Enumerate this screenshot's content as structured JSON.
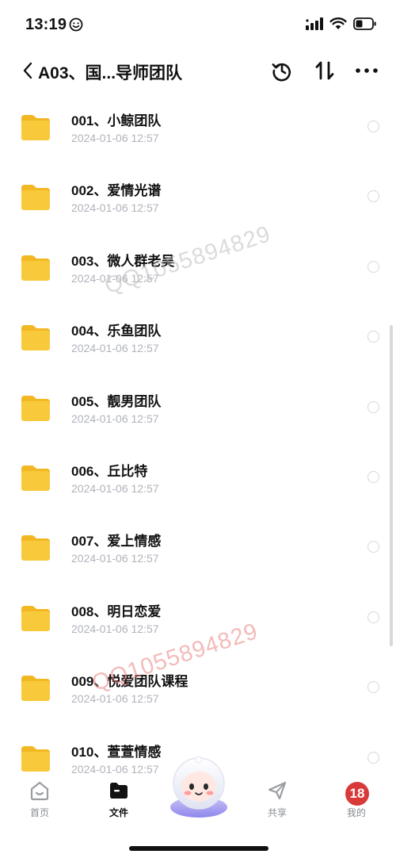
{
  "status_bar": {
    "time": "13:19"
  },
  "nav": {
    "title": "A03、国...导师团队"
  },
  "files": [
    {
      "name": "001、小鲸团队",
      "date": "2024-01-06 12:57"
    },
    {
      "name": "002、爱情光谱",
      "date": "2024-01-06 12:57"
    },
    {
      "name": "003、微人群老吴",
      "date": "2024-01-06 12:57"
    },
    {
      "name": "004、乐鱼团队",
      "date": "2024-01-06 12:57"
    },
    {
      "name": "005、靓男团队",
      "date": "2024-01-06 12:57"
    },
    {
      "name": "006、丘比特",
      "date": "2024-01-06 12:57"
    },
    {
      "name": "007、爱上情感",
      "date": "2024-01-06 12:57"
    },
    {
      "name": "008、明日恋爱",
      "date": "2024-01-06 12:57"
    },
    {
      "name": "009、悦爱团队课程",
      "date": "2024-01-06 12:57"
    },
    {
      "name": "010、萱萱情感",
      "date": "2024-01-06 12:57"
    }
  ],
  "watermarks": [
    "QQ1055894829",
    "QQ1055894829"
  ],
  "tab_bar": {
    "tabs": [
      {
        "label": "首页",
        "icon": "home-icon",
        "active": false
      },
      {
        "label": "文件",
        "icon": "folder-icon",
        "active": true
      },
      {
        "label": "共享",
        "icon": "send-icon",
        "active": false
      },
      {
        "label": "我的",
        "icon": "avatar",
        "active": false
      }
    ],
    "profile_badge": "18"
  },
  "colors": {
    "folder": "#f8c93a",
    "date_text": "#b0b3bb",
    "badge": "#d83a3a"
  }
}
